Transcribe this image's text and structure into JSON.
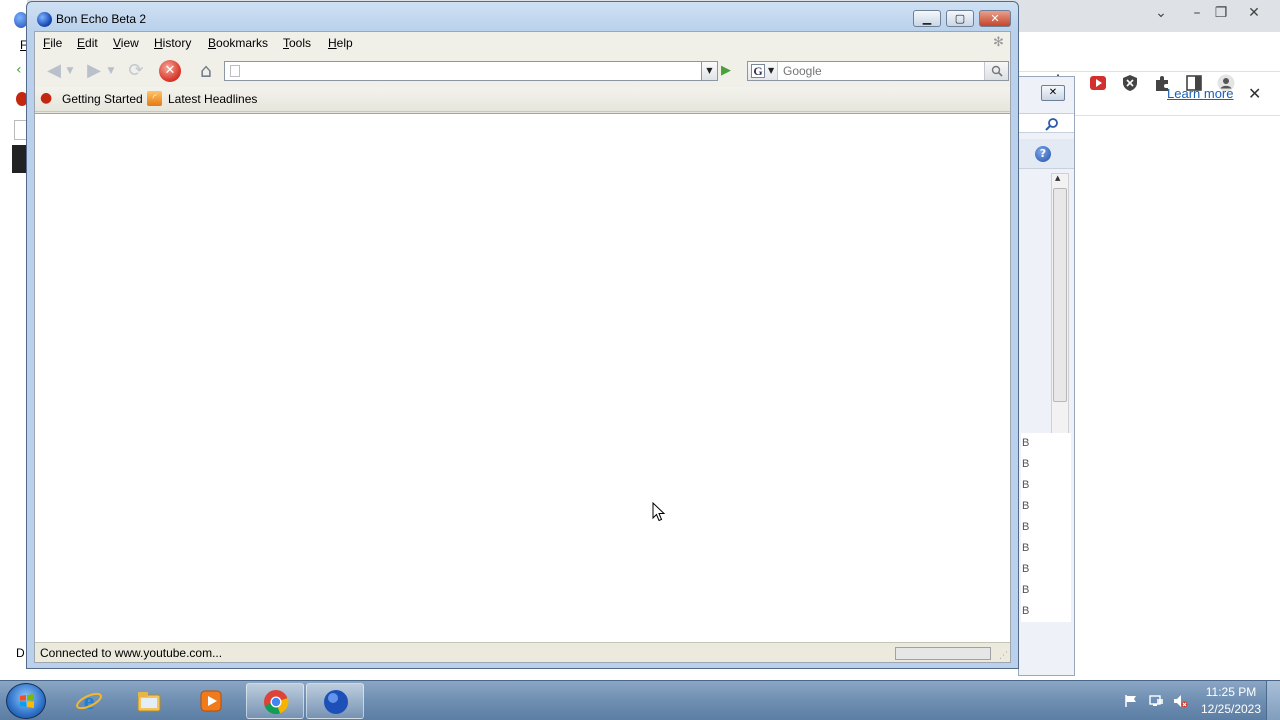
{
  "firefox": {
    "title": "Bon Echo Beta 2",
    "menu": [
      "File",
      "Edit",
      "View",
      "History",
      "Bookmarks",
      "Tools",
      "Help"
    ],
    "url_value": "",
    "search_placeholder": "Google",
    "bookmarks": [
      "Getting Started",
      "Latest Headlines"
    ],
    "status_text": "Connected to www.youtube.com...",
    "progress": 0
  },
  "background": {
    "learn_more": "Learn more",
    "panel_rows": [
      "B",
      "B",
      "B",
      "B",
      "B",
      "B",
      "B",
      "B",
      "B"
    ]
  },
  "taskbar": {
    "time": "11:25 PM",
    "date": "12/25/2023",
    "apps": [
      "internet-explorer",
      "file-explorer",
      "media-player",
      "chrome",
      "firefox"
    ]
  },
  "colors": {
    "accent": "#1d4fb8",
    "taskbar": "#6f8fb2",
    "stop": "#d8392b"
  }
}
